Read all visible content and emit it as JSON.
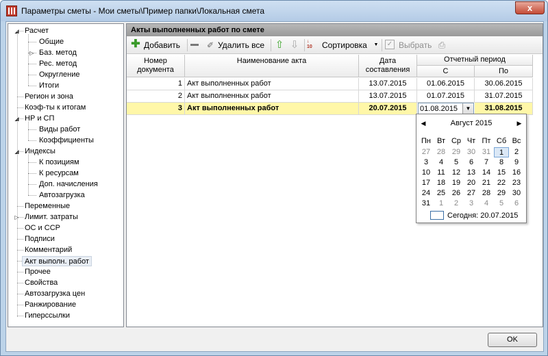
{
  "window": {
    "title": "Параметры сметы - Мои сметы\\Пример папки\\Локальная смета",
    "close_label": "x"
  },
  "tree": {
    "items": [
      {
        "label": "Расчет",
        "toggle": "◢"
      },
      {
        "label": "Общие"
      },
      {
        "label": "Баз. метод",
        "toggle": "▷"
      },
      {
        "label": "Рес. метод"
      },
      {
        "label": "Округление"
      },
      {
        "label": "Итоги"
      },
      {
        "label": "Регион и зона"
      },
      {
        "label": "Коэф-ты к итогам"
      },
      {
        "label": "НР и СП",
        "toggle": "◢"
      },
      {
        "label": "Виды работ"
      },
      {
        "label": "Коэффициенты"
      },
      {
        "label": "Индексы",
        "toggle": "◢"
      },
      {
        "label": "К позициям"
      },
      {
        "label": "К ресурсам"
      },
      {
        "label": "Доп. начисления"
      },
      {
        "label": "Автозагрузка"
      },
      {
        "label": "Переменные"
      },
      {
        "label": "Лимит. затраты",
        "toggle": "▷"
      },
      {
        "label": "ОС и ССР"
      },
      {
        "label": "Подписи"
      },
      {
        "label": "Комментарий"
      },
      {
        "label": "Акт выполн. работ",
        "selected": true
      },
      {
        "label": "Прочее"
      },
      {
        "label": "Свойства"
      },
      {
        "label": "Автозагрузка цен"
      },
      {
        "label": "Ранжирование"
      },
      {
        "label": "Гиперссылки"
      }
    ]
  },
  "panel": {
    "header": "Акты выполненных работ по смете",
    "toolbar": {
      "add_label": "Добавить",
      "delete_all_label": "Удалить все",
      "sort_label": "Сортировка",
      "select_label": "Выбрать",
      "sort_icon_digits": "10"
    },
    "grid": {
      "columns": {
        "num": "Номер документа",
        "name": "Наименование акта",
        "date": "Дата составления",
        "period": "Отчетный период",
        "from": "С",
        "to": "По"
      },
      "rows": [
        {
          "num": "1",
          "name": "Акт выполненных работ",
          "date": "13.07.2015",
          "from": "01.06.2015",
          "to": "30.06.2015"
        },
        {
          "num": "2",
          "name": "Акт выполненных работ",
          "date": "13.07.2015",
          "from": "01.07.2015",
          "to": "31.07.2015"
        },
        {
          "num": "3",
          "name": "Акт выполненных работ",
          "date": "20.07.2015",
          "from": "01.08.2015",
          "to": "31.08.2015"
        }
      ]
    }
  },
  "calendar": {
    "title": "Август 2015",
    "weekdays": [
      "Пн",
      "Вт",
      "Ср",
      "Чт",
      "Пт",
      "Сб",
      "Вс"
    ],
    "weeks": [
      [
        "27",
        "28",
        "29",
        "30",
        "31",
        "1",
        "2"
      ],
      [
        "3",
        "4",
        "5",
        "6",
        "7",
        "8",
        "9"
      ],
      [
        "10",
        "11",
        "12",
        "13",
        "14",
        "15",
        "16"
      ],
      [
        "17",
        "18",
        "19",
        "20",
        "21",
        "22",
        "23"
      ],
      [
        "24",
        "25",
        "26",
        "27",
        "28",
        "29",
        "30"
      ],
      [
        "31",
        "1",
        "2",
        "3",
        "4",
        "5",
        "6"
      ]
    ],
    "selected_day": "1",
    "today_label": "Сегодня: 20.07.2015"
  },
  "footer": {
    "ok_label": "OK"
  },
  "colors": {
    "highlight_row": "#fff7a8",
    "header": "#a8a8a8",
    "titlebar": "#bcd3e9"
  }
}
